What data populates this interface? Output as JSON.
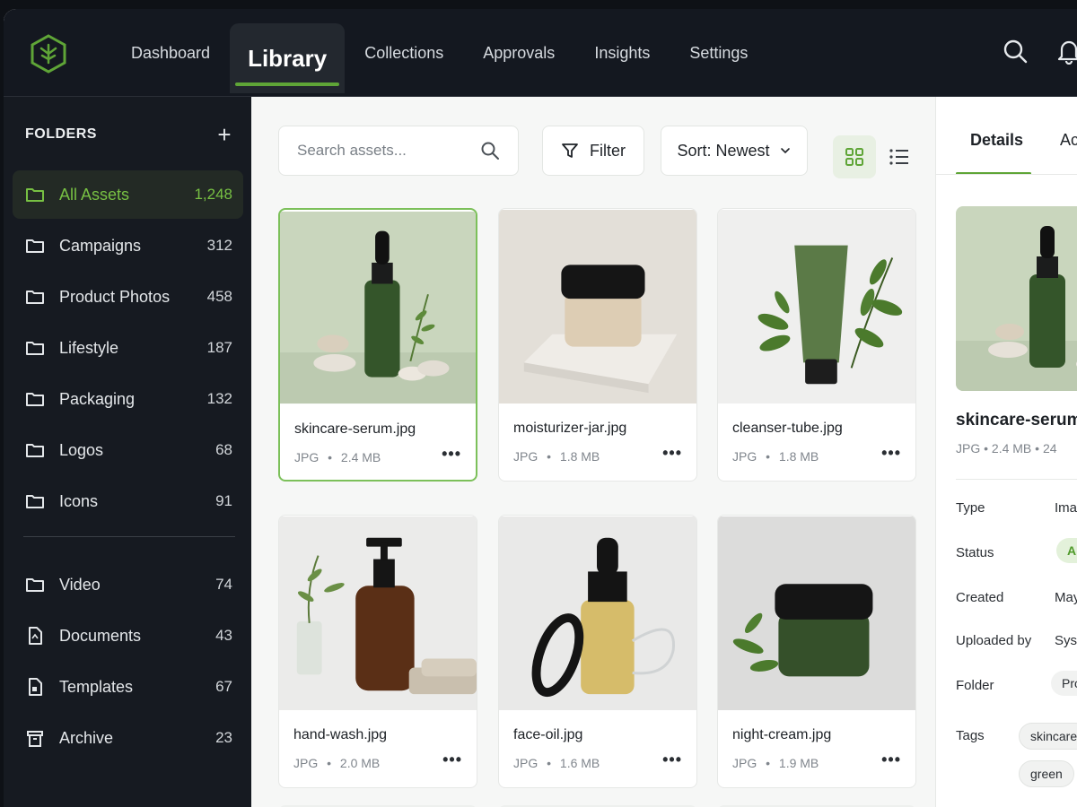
{
  "nav": {
    "items": [
      {
        "label": "Dashboard",
        "active": false
      },
      {
        "label": "Library",
        "active": true
      },
      {
        "label": "Collections",
        "active": false
      },
      {
        "label": "Approvals",
        "active": false
      },
      {
        "label": "Insights",
        "active": false
      },
      {
        "label": "Settings",
        "active": false
      }
    ]
  },
  "sidebar": {
    "header": "FOLDERS",
    "add_label": "+",
    "folders": [
      {
        "label": "All Assets",
        "count": "1,248",
        "icon": "folder-icon",
        "active": true
      },
      {
        "label": "Campaigns",
        "count": "312",
        "icon": "folder-icon"
      },
      {
        "label": "Product Photos",
        "count": "458",
        "icon": "folder-icon"
      },
      {
        "label": "Lifestyle",
        "count": "187",
        "icon": "folder-icon"
      },
      {
        "label": "Packaging",
        "count": "132",
        "icon": "folder-icon"
      },
      {
        "label": "Logos",
        "count": "68",
        "icon": "folder-icon"
      },
      {
        "label": "Icons",
        "count": "91",
        "icon": "folder-icon"
      },
      {
        "label": "Video",
        "count": "74",
        "icon": "folder-icon"
      },
      {
        "label": "Documents",
        "count": "43",
        "icon": "document-icon"
      },
      {
        "label": "Templates",
        "count": "67",
        "icon": "template-icon"
      },
      {
        "label": "Archive",
        "count": "23",
        "icon": "archive-icon"
      }
    ]
  },
  "toolbar": {
    "search_placeholder": "Search assets...",
    "filter_label": "Filter",
    "sort_label": "Sort: Newest"
  },
  "assets": [
    {
      "name": "skincare-serum.jpg",
      "type": "JPG",
      "size": "2.4 MB",
      "selected": true
    },
    {
      "name": "moisturizer-jar.jpg",
      "type": "JPG",
      "size": "1.8 MB"
    },
    {
      "name": "cleanser-tube.jpg",
      "type": "JPG",
      "size": "1.8 MB"
    },
    {
      "name": "hand-wash.jpg",
      "type": "JPG",
      "size": "2.0 MB"
    },
    {
      "name": "face-oil.jpg",
      "type": "JPG",
      "size": "1.6 MB"
    },
    {
      "name": "night-cream.jpg",
      "type": "JPG",
      "size": "1.9 MB"
    }
  ],
  "asset_meta_sep": "•",
  "asset_more": "•••",
  "details": {
    "tabs": [
      "Details",
      "Act"
    ],
    "name": "skincare-serum",
    "meta": "JPG  •  2.4 MB  •  24",
    "rows": [
      {
        "key": "Type",
        "value": "Ima"
      },
      {
        "key": "Status",
        "value": "Ap"
      },
      {
        "key": "Created",
        "value": "May"
      },
      {
        "key": "Uploaded by",
        "value": "Syst"
      },
      {
        "key": "Folder",
        "value": "Pro"
      },
      {
        "key": "Tags",
        "value": ""
      }
    ],
    "tags": [
      "skincare",
      "green"
    ]
  },
  "colors": {
    "accent": "#5fa537",
    "accent_light": "#77c043",
    "topbar": "#141820",
    "sidebar": "#161a21"
  }
}
